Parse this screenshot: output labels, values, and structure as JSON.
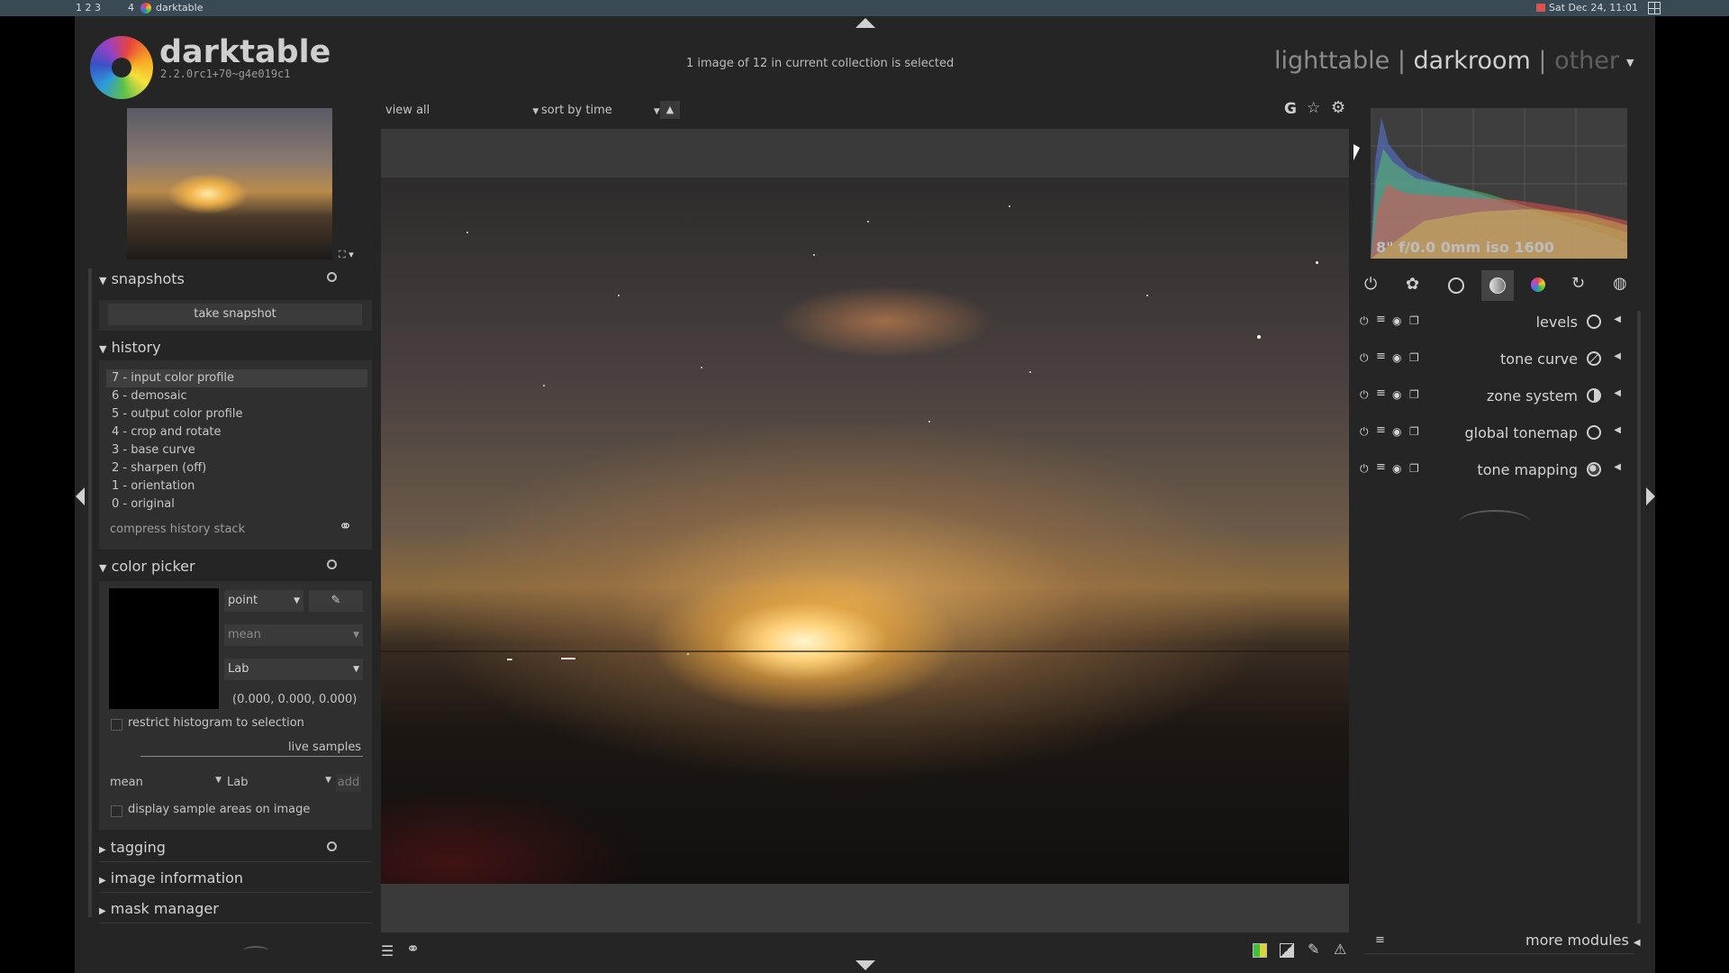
{
  "taskbar": {
    "workspaces": "1 2 3",
    "window_index": "4",
    "window_title": "darktable",
    "clock": "Sat Dec 24, 11:01"
  },
  "app": {
    "name": "darktable",
    "version": "2.2.0rc1+70~g4e019c1",
    "status": "1 image of 12 in current collection is selected",
    "views": [
      "lighttable",
      "darkroom",
      "other"
    ],
    "active_view": "darkroom"
  },
  "filmstrip_bar": {
    "view_label": "view",
    "view_value": "all",
    "sort_label": "sort by",
    "sort_value": "time"
  },
  "histogram": {
    "exif": "8\" f/0.0 0mm iso 1600"
  },
  "snapshots": {
    "title": "snapshots",
    "take_snapshot": "take snapshot"
  },
  "history": {
    "title": "history",
    "items": [
      "7 - input color profile",
      "6 - demosaic",
      "5 - output color profile",
      "4 - crop and rotate",
      "3 - base curve",
      "2 - sharpen (off)",
      "1 - orientation",
      "0 - original"
    ],
    "compress": "compress history stack"
  },
  "color_picker": {
    "title": "color picker",
    "mode": "point",
    "stat": "mean",
    "space": "Lab",
    "values": "(0.000, 0.000, 0.000)",
    "restrict": "restrict histogram to selection",
    "live_samples": "live samples",
    "sample_stat": "mean",
    "sample_space": "Lab",
    "add": "add",
    "display_samples": "display sample areas on image"
  },
  "collapsed_sections": {
    "tagging": "tagging",
    "image_information": "image information",
    "mask_manager": "mask manager"
  },
  "modules": {
    "items": [
      "levels",
      "tone curve",
      "zone system",
      "global tonemap",
      "tone mapping"
    ],
    "more_modules": "more modules"
  },
  "colors": {
    "app_bg": "#252525",
    "panel_bg": "#2f2f2f",
    "topbar": "#394a55",
    "text": "#cfcfcf"
  }
}
